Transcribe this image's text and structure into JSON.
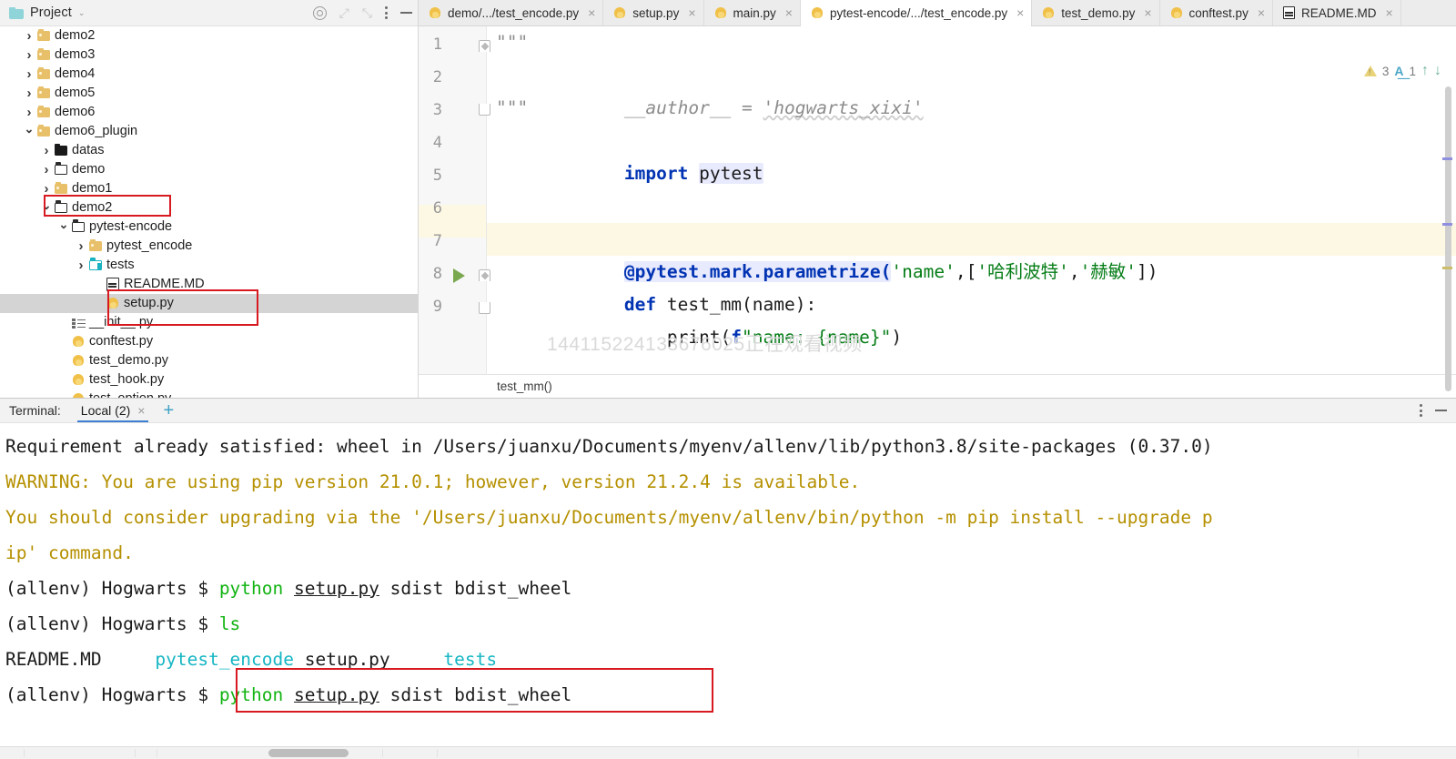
{
  "project_panel": {
    "title": "Project",
    "chevron": "⌄",
    "icons": {
      "target": "target-icon",
      "expand": "expand-icon",
      "collapse": "collapse-icon",
      "options": "kebab-icon",
      "hide": "minimize-icon"
    },
    "tree": [
      {
        "label": "demo2",
        "indent": 1,
        "arrow": "right",
        "icon": "folder-yellow",
        "selected": false
      },
      {
        "label": "demo3",
        "indent": 1,
        "arrow": "right",
        "icon": "folder-yellow",
        "selected": false
      },
      {
        "label": "demo4",
        "indent": 1,
        "arrow": "right",
        "icon": "folder-yellow",
        "selected": false
      },
      {
        "label": "demo5",
        "indent": 1,
        "arrow": "right",
        "icon": "folder-yellow",
        "selected": false
      },
      {
        "label": "demo6",
        "indent": 1,
        "arrow": "right",
        "icon": "folder-yellow",
        "selected": false
      },
      {
        "label": "demo6_plugin",
        "indent": 1,
        "arrow": "down",
        "icon": "folder-yellow",
        "selected": false
      },
      {
        "label": "datas",
        "indent": 2,
        "arrow": "right",
        "icon": "folder-black",
        "selected": false
      },
      {
        "label": "demo",
        "indent": 2,
        "arrow": "right",
        "icon": "folder-white",
        "selected": false
      },
      {
        "label": "demo1",
        "indent": 2,
        "arrow": "right",
        "icon": "folder-yellow",
        "selected": false
      },
      {
        "label": "demo2",
        "indent": 2,
        "arrow": "down",
        "icon": "folder-white",
        "selected": false
      },
      {
        "label": "pytest-encode",
        "indent": 3,
        "arrow": "down",
        "icon": "folder-white",
        "selected": false
      },
      {
        "label": "pytest_encode",
        "indent": 4,
        "arrow": "right",
        "icon": "folder-yellow",
        "selected": false
      },
      {
        "label": "tests",
        "indent": 4,
        "arrow": "right",
        "icon": "folder-teal",
        "selected": false
      },
      {
        "label": "README.MD",
        "indent": 5,
        "arrow": "none",
        "icon": "markdown",
        "selected": false
      },
      {
        "label": "setup.py",
        "indent": 5,
        "arrow": "none",
        "icon": "python",
        "selected": true
      },
      {
        "label": "__init__.py",
        "indent": 3,
        "arrow": "none",
        "icon": "init",
        "selected": false
      },
      {
        "label": "conftest.py",
        "indent": 3,
        "arrow": "none",
        "icon": "python",
        "selected": false
      },
      {
        "label": "test_demo.py",
        "indent": 3,
        "arrow": "none",
        "icon": "python",
        "selected": false
      },
      {
        "label": "test_hook.py",
        "indent": 3,
        "arrow": "none",
        "icon": "python",
        "selected": false
      },
      {
        "label": "test_option.py",
        "indent": 3,
        "arrow": "none",
        "icon": "python",
        "selected": false
      }
    ]
  },
  "editor": {
    "tabs": [
      {
        "label": "demo/.../test_encode.py",
        "icon": "python",
        "active": false,
        "close": "×"
      },
      {
        "label": "setup.py",
        "icon": "python",
        "active": false,
        "close": "×"
      },
      {
        "label": "main.py",
        "icon": "python",
        "active": false,
        "close": "×"
      },
      {
        "label": "pytest-encode/.../test_encode.py",
        "icon": "python",
        "active": true,
        "close": "×"
      },
      {
        "label": "test_demo.py",
        "icon": "python",
        "active": false,
        "close": "×"
      },
      {
        "label": "conftest.py",
        "icon": "python",
        "active": false,
        "close": "×"
      },
      {
        "label": "README.MD",
        "icon": "markdown",
        "active": false,
        "close": "×"
      }
    ],
    "line_numbers": [
      "1",
      "2",
      "3",
      "4",
      "5",
      "6",
      "7",
      "8",
      "9"
    ],
    "code": {
      "l1": "\"\"\"",
      "l2_a": "__author__ = ",
      "l2_b": "'hogwarts_xixi'",
      "l3": "\"\"\"",
      "l4_kw": "import",
      "l4_mod": "pytest",
      "l7_a": "@pytest.mark.parametrize(",
      "l7_name": "'name'",
      "l7_comma": ",[",
      "l7_s1": "'哈利波特'",
      "l7_c2": ",",
      "l7_s2": "'赫敏'",
      "l7_end": "])",
      "l8_kw": "def",
      "l8_sig": " test_mm(name):",
      "l9_a": "    print(",
      "l9_f": "f",
      "l9_str": "\"name: {name}\"",
      "l9_end": ")"
    },
    "watermark": "144115224133676025正在观看视频",
    "breadcrumb": "test_mm()",
    "inspections": {
      "warning_count": "3",
      "spell_count": "1",
      "up_arrow": "↑",
      "down_arrow": "↓"
    }
  },
  "terminal": {
    "label": "Terminal:",
    "tab": "Local (2)",
    "tab_close": "×",
    "add": "+",
    "lines": [
      {
        "segments": [
          {
            "t": "Requirement already satisfied: wheel in /Users/juanxu/Documents/myenv/allenv/lib/python3.8/site-packages (0.37.0)",
            "c": "plain"
          }
        ]
      },
      {
        "segments": [
          {
            "t": "WARNING: You are using pip version 21.0.1; however, version 21.2.4 is available.",
            "c": "yellow"
          }
        ]
      },
      {
        "segments": [
          {
            "t": "You should consider upgrading via the '/Users/juanxu/Documents/myenv/allenv/bin/python -m pip install --upgrade p",
            "c": "yellow"
          }
        ]
      },
      {
        "segments": [
          {
            "t": "ip' command.",
            "c": "yellow"
          }
        ]
      },
      {
        "segments": [
          {
            "t": "(allenv) Hogwarts $ ",
            "c": "plain"
          },
          {
            "t": "python ",
            "c": "green"
          },
          {
            "t": "setup.py",
            "c": "under"
          },
          {
            "t": " sdist bdist_wheel",
            "c": "plain"
          }
        ]
      },
      {
        "segments": [
          {
            "t": "(allenv) Hogwarts $ ",
            "c": "plain"
          },
          {
            "t": "ls",
            "c": "green"
          }
        ]
      },
      {
        "segments": [
          {
            "t": "README.MD     ",
            "c": "plain"
          },
          {
            "t": "pytest_encode",
            "c": "cyan"
          },
          {
            "t": " setup.py     ",
            "c": "plain"
          },
          {
            "t": "tests",
            "c": "cyan"
          }
        ]
      },
      {
        "segments": [
          {
            "t": "(allenv) Hogwarts $ ",
            "c": "plain"
          },
          {
            "t": "python ",
            "c": "green"
          },
          {
            "t": "setup.py",
            "c": "under"
          },
          {
            "t": " sdist bdist_wheel",
            "c": "plain"
          }
        ]
      }
    ],
    "icons": {
      "options": "kebab-icon",
      "hide": "minimize-icon"
    }
  },
  "annotations": {
    "color": "#d71920",
    "boxes": [
      {
        "name": "demo2-folder-highlight"
      },
      {
        "name": "setup-py-file-highlight"
      },
      {
        "name": "terminal-command-highlight"
      }
    ]
  }
}
